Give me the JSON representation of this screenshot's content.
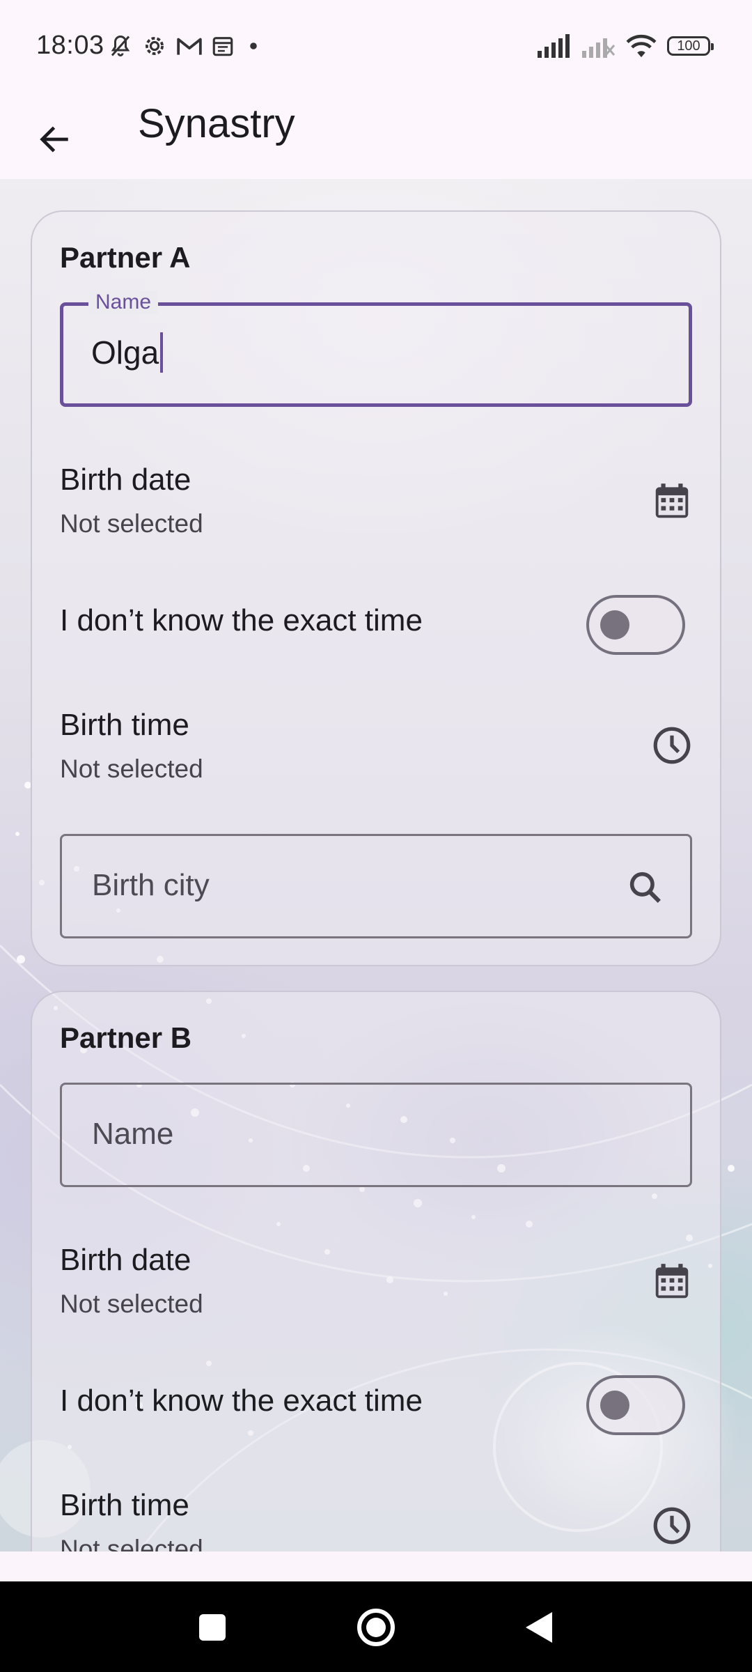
{
  "status_bar": {
    "time": "18:03",
    "battery": "100",
    "left_icons": [
      "bell-muted-icon",
      "settings-icon",
      "gmail-icon",
      "calendar-icon",
      "dot-icon"
    ],
    "right_icons": [
      "signal-icon",
      "signal-off-icon",
      "wifi-icon",
      "battery-icon"
    ]
  },
  "app_bar": {
    "title": "Synastry",
    "back_icon": "arrow-back-icon"
  },
  "partner_a": {
    "title": "Partner A",
    "name_label": "Name",
    "name_value": "Olga",
    "birth_date_label": "Birth date",
    "birth_date_value": "Not selected",
    "unknown_time_label": "I don’t know the exact time",
    "unknown_time_on": false,
    "birth_time_label": "Birth time",
    "birth_time_value": "Not selected",
    "birth_city_placeholder": "Birth city"
  },
  "partner_b": {
    "title": "Partner B",
    "name_placeholder": "Name",
    "birth_date_label": "Birth date",
    "birth_date_value": "Not selected",
    "unknown_time_label": "I don’t know the exact time",
    "unknown_time_on": false,
    "birth_time_label": "Birth time",
    "birth_time_value": "Not selected"
  },
  "nav_bar": {
    "buttons": [
      "recents-square-icon",
      "home-circle-icon",
      "back-triangle-icon"
    ]
  },
  "colors": {
    "accent": "#6a4f9a",
    "outline": "#79747e",
    "text": "#1c1b1f",
    "app_bar_bg": "#fdf6fc"
  }
}
